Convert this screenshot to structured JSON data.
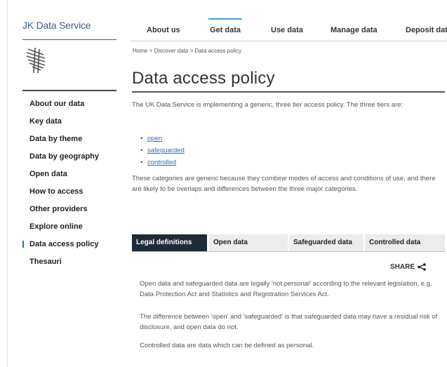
{
  "header": {
    "logo_text": "JK Data Service"
  },
  "topnav": {
    "items": [
      {
        "label": "About us"
      },
      {
        "label": "Get data"
      },
      {
        "label": "Use data"
      },
      {
        "label": "Manage data"
      },
      {
        "label": "Deposit dat"
      }
    ],
    "active": "Get data",
    "accent_color": "#3aa3d9"
  },
  "sidebar": {
    "items": [
      {
        "label": "About our data"
      },
      {
        "label": "Key data"
      },
      {
        "label": "Data by theme"
      },
      {
        "label": "Data by geography"
      },
      {
        "label": "Open data"
      },
      {
        "label": "How to access"
      },
      {
        "label": "Other providers"
      },
      {
        "label": "Explore online"
      },
      {
        "label": "Data access policy"
      },
      {
        "label": "Thesauri"
      }
    ],
    "active": "Data access policy"
  },
  "breadcrumb": {
    "items": [
      "Home",
      "Discover data",
      "Data access policy"
    ],
    "separator": " > "
  },
  "main": {
    "title": "Data access policy",
    "intro": "The UK Data Service is implementing a generic, three tier access policy. The three tiers are:",
    "tiers": [
      "open",
      "safeguarded",
      "controlled"
    ],
    "categories_text": "These categories are generic because they combine modes of access and conditions of use, and there are likely to be overlaps and differences between the three major categories."
  },
  "tabs": {
    "items": [
      {
        "label": "Legal definitions"
      },
      {
        "label": "Open data"
      },
      {
        "label": "Safeguarded data"
      },
      {
        "label": "Controlled data"
      }
    ],
    "active": "Legal definitions",
    "active_color": "#1f2b37"
  },
  "tab_content": {
    "share_label": "SHARE",
    "paragraphs": [
      "Open data and safeguarded data are legally 'not personal' according to the relevant legislation, e.g. Data Protection Act and Statistics and Registration Services Act.",
      "The difference between 'open' and 'safeguarded' is that safeguarded data may have a residual risk of disclosure, and open data do not.",
      "Controlled data are data which can be defined as personal."
    ]
  },
  "icons": {
    "logo": "ukds-logo-icon",
    "share": "share-icon"
  }
}
